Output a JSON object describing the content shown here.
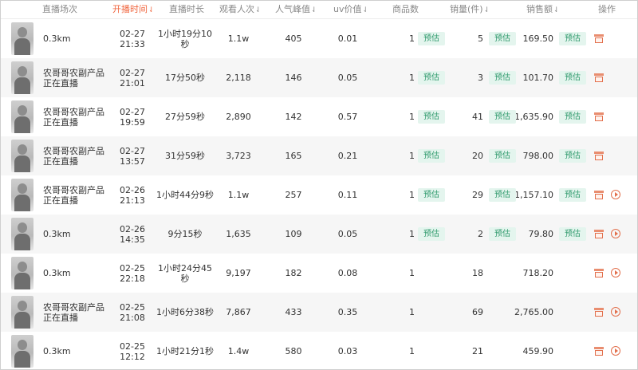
{
  "headers": {
    "session": "直播场次",
    "start_time": "开播时间",
    "duration": "直播时长",
    "views": "观看人次",
    "peak": "人气峰值",
    "uv": "uv价值",
    "products": "商品数",
    "sales_qty": "销量(件)",
    "revenue": "销售额",
    "action": "操作"
  },
  "estimate_label": "预估",
  "rows": [
    {
      "name": "0.3km",
      "date": "02-27",
      "time": "21:33",
      "duration": "1小时19分10秒",
      "views": "1.1w",
      "peak": "405",
      "uv": "0.01",
      "products": "1",
      "sales_qty": "5",
      "revenue": "169.50",
      "estimated": true,
      "has_play": false
    },
    {
      "name": "农哥哥农副产品正在直播",
      "date": "02-27",
      "time": "21:01",
      "duration": "17分50秒",
      "views": "2,118",
      "peak": "146",
      "uv": "0.05",
      "products": "1",
      "sales_qty": "3",
      "revenue": "101.70",
      "estimated": true,
      "has_play": false
    },
    {
      "name": "农哥哥农副产品正在直播",
      "date": "02-27",
      "time": "19:59",
      "duration": "27分59秒",
      "views": "2,890",
      "peak": "142",
      "uv": "0.57",
      "products": "1",
      "sales_qty": "41",
      "revenue": "1,635.90",
      "estimated": true,
      "has_play": false
    },
    {
      "name": "农哥哥农副产品正在直播",
      "date": "02-27",
      "time": "13:57",
      "duration": "31分59秒",
      "views": "3,723",
      "peak": "165",
      "uv": "0.21",
      "products": "1",
      "sales_qty": "20",
      "revenue": "798.00",
      "estimated": true,
      "has_play": false
    },
    {
      "name": "农哥哥农副产品正在直播",
      "date": "02-26",
      "time": "21:13",
      "duration": "1小时44分9秒",
      "views": "1.1w",
      "peak": "257",
      "uv": "0.11",
      "products": "1",
      "sales_qty": "29",
      "revenue": "1,157.10",
      "estimated": true,
      "has_play": true
    },
    {
      "name": "0.3km",
      "date": "02-26",
      "time": "14:35",
      "duration": "9分15秒",
      "views": "1,635",
      "peak": "109",
      "uv": "0.05",
      "products": "1",
      "sales_qty": "2",
      "revenue": "79.80",
      "estimated": true,
      "has_play": true
    },
    {
      "name": "0.3km",
      "date": "02-25",
      "time": "22:18",
      "duration": "1小时24分45秒",
      "views": "9,197",
      "peak": "182",
      "uv": "0.08",
      "products": "1",
      "sales_qty": "18",
      "revenue": "718.20",
      "estimated": false,
      "has_play": true
    },
    {
      "name": "农哥哥农副产品正在直播",
      "date": "02-25",
      "time": "21:08",
      "duration": "1小时6分38秒",
      "views": "7,867",
      "peak": "433",
      "uv": "0.35",
      "products": "1",
      "sales_qty": "69",
      "revenue": "2,765.00",
      "estimated": false,
      "has_play": true
    },
    {
      "name": "0.3km",
      "date": "02-25",
      "time": "12:12",
      "duration": "1小时21分1秒",
      "views": "1.4w",
      "peak": "580",
      "uv": "0.03",
      "products": "1",
      "sales_qty": "21",
      "revenue": "459.90",
      "estimated": false,
      "has_play": true
    }
  ]
}
